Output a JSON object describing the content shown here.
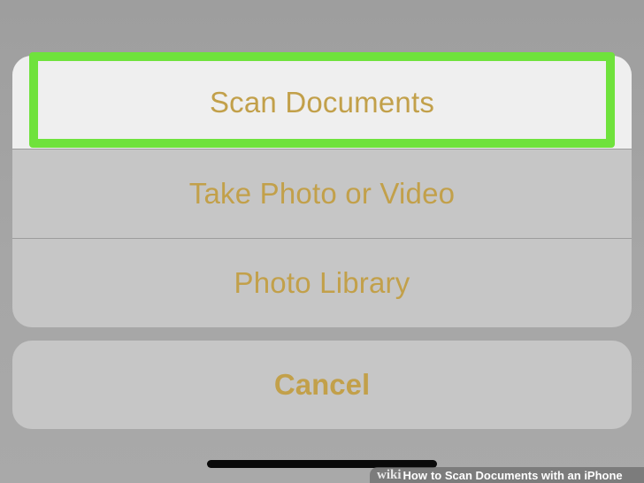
{
  "action_sheet": {
    "options": [
      {
        "label": "Scan Documents",
        "highlighted": true
      },
      {
        "label": "Take Photo or Video",
        "highlighted": false
      },
      {
        "label": "Photo Library",
        "highlighted": false
      }
    ],
    "cancel_label": "Cancel"
  },
  "watermark": {
    "brand": "wiki",
    "how": "How",
    "title": "to Scan Documents with an iPhone"
  },
  "colors": {
    "accent_text": "#c2a04a",
    "highlight_border": "#6fe23c",
    "sheet_background": "#c6c6c6",
    "selected_row_background": "#efefef",
    "backdrop": "#a2a2a2"
  }
}
